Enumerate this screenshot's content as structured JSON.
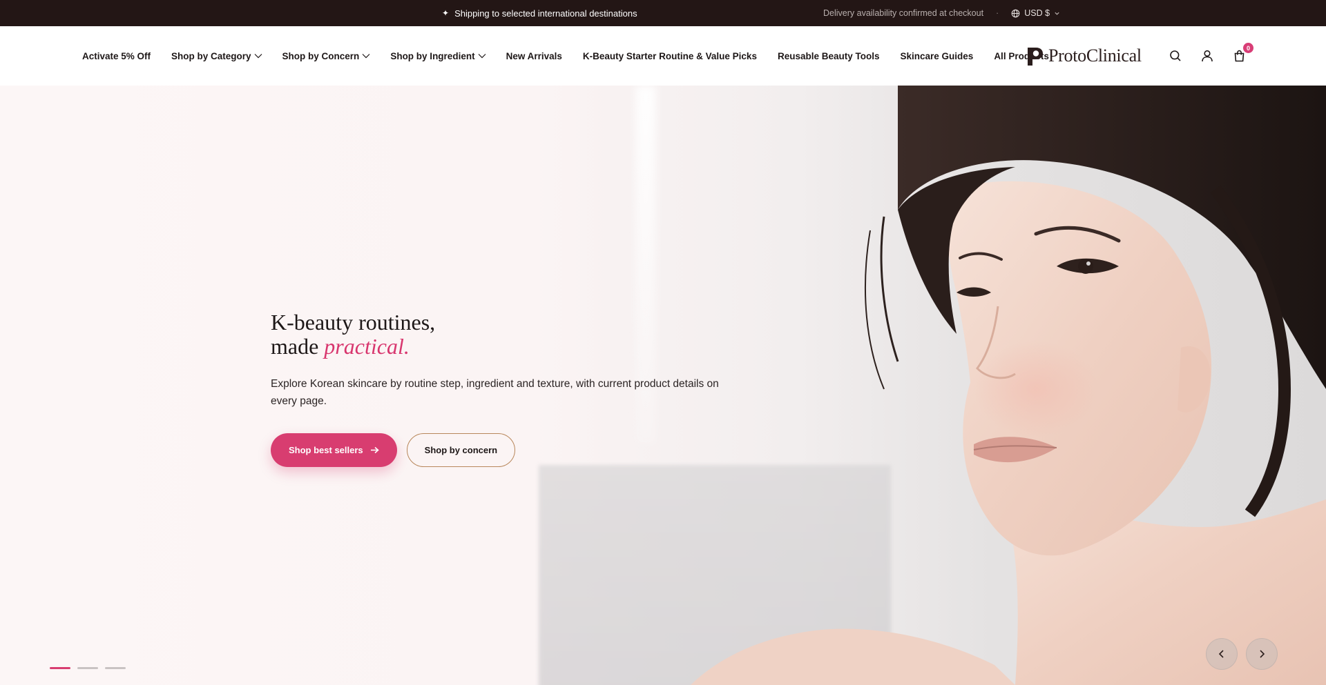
{
  "topbar": {
    "promo_icon": "sparkle-icon",
    "promo_text": "Shipping to selected international destinations",
    "delivery_text": "Delivery availability confirmed at checkout",
    "separator": "·",
    "currency": "USD $"
  },
  "nav": {
    "items": [
      {
        "label": "Activate 5% Off",
        "has_dropdown": false
      },
      {
        "label": "Shop by Category",
        "has_dropdown": true
      },
      {
        "label": "Shop by Concern",
        "has_dropdown": true
      },
      {
        "label": "Shop by Ingredient",
        "has_dropdown": true
      },
      {
        "label": "New Arrivals",
        "has_dropdown": false
      },
      {
        "label": "K-Beauty Starter Routine & Value Picks",
        "has_dropdown": false
      },
      {
        "label": "Reusable Beauty Tools",
        "has_dropdown": false
      },
      {
        "label": "Skincare Guides",
        "has_dropdown": false
      },
      {
        "label": "All Products",
        "has_dropdown": false
      }
    ]
  },
  "logo": {
    "text": "ProtoClinical"
  },
  "header_icons": {
    "search": "search-icon",
    "account": "user-icon",
    "cart": "shopping-bag-icon",
    "cart_count": "0"
  },
  "hero": {
    "title_line1": "K-beauty routines,",
    "title_line2_prefix": "made ",
    "title_line2_accent": "practical.",
    "subtitle": "Explore Korean skincare by routine step, ingredient and texture, with current product details on every page.",
    "cta_primary": "Shop best sellers",
    "cta_secondary": "Shop by concern",
    "slides": 3,
    "active_slide": 1
  },
  "colors": {
    "topbar_bg": "#231615",
    "accent": "#d83d70",
    "secondary_border": "#b8865a"
  }
}
